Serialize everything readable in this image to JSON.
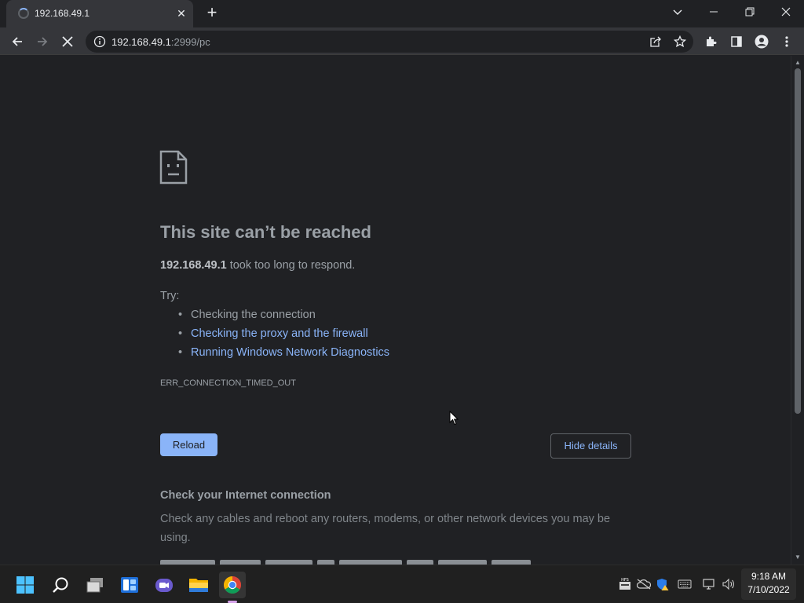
{
  "browser": {
    "tab_title": "192.168.49.1",
    "url_host": "192.168.49.1",
    "url_rest": ":2999/pc"
  },
  "error_page": {
    "title": "This site can’t be reached",
    "host": "192.168.49.1",
    "description_suffix": " took too long to respond.",
    "try_label": "Try:",
    "suggestions": [
      "Checking the connection",
      "Checking the proxy and the firewall",
      "Running Windows Network Diagnostics"
    ],
    "error_code": "ERR_CONNECTION_TIMED_OUT",
    "reload_label": "Reload",
    "hide_details_label": "Hide details",
    "details_title": "Check your Internet connection",
    "details_body": "Check any cables and reboot any routers, modems, or other network devices you may be using."
  },
  "taskbar": {
    "time": "9:18 AM",
    "date": "7/10/2022"
  },
  "colors": {
    "background": "#202124",
    "toolbar": "#35363a",
    "link": "#8ab4f8",
    "text": "#9aa0a6",
    "taskbar": "#202020"
  }
}
